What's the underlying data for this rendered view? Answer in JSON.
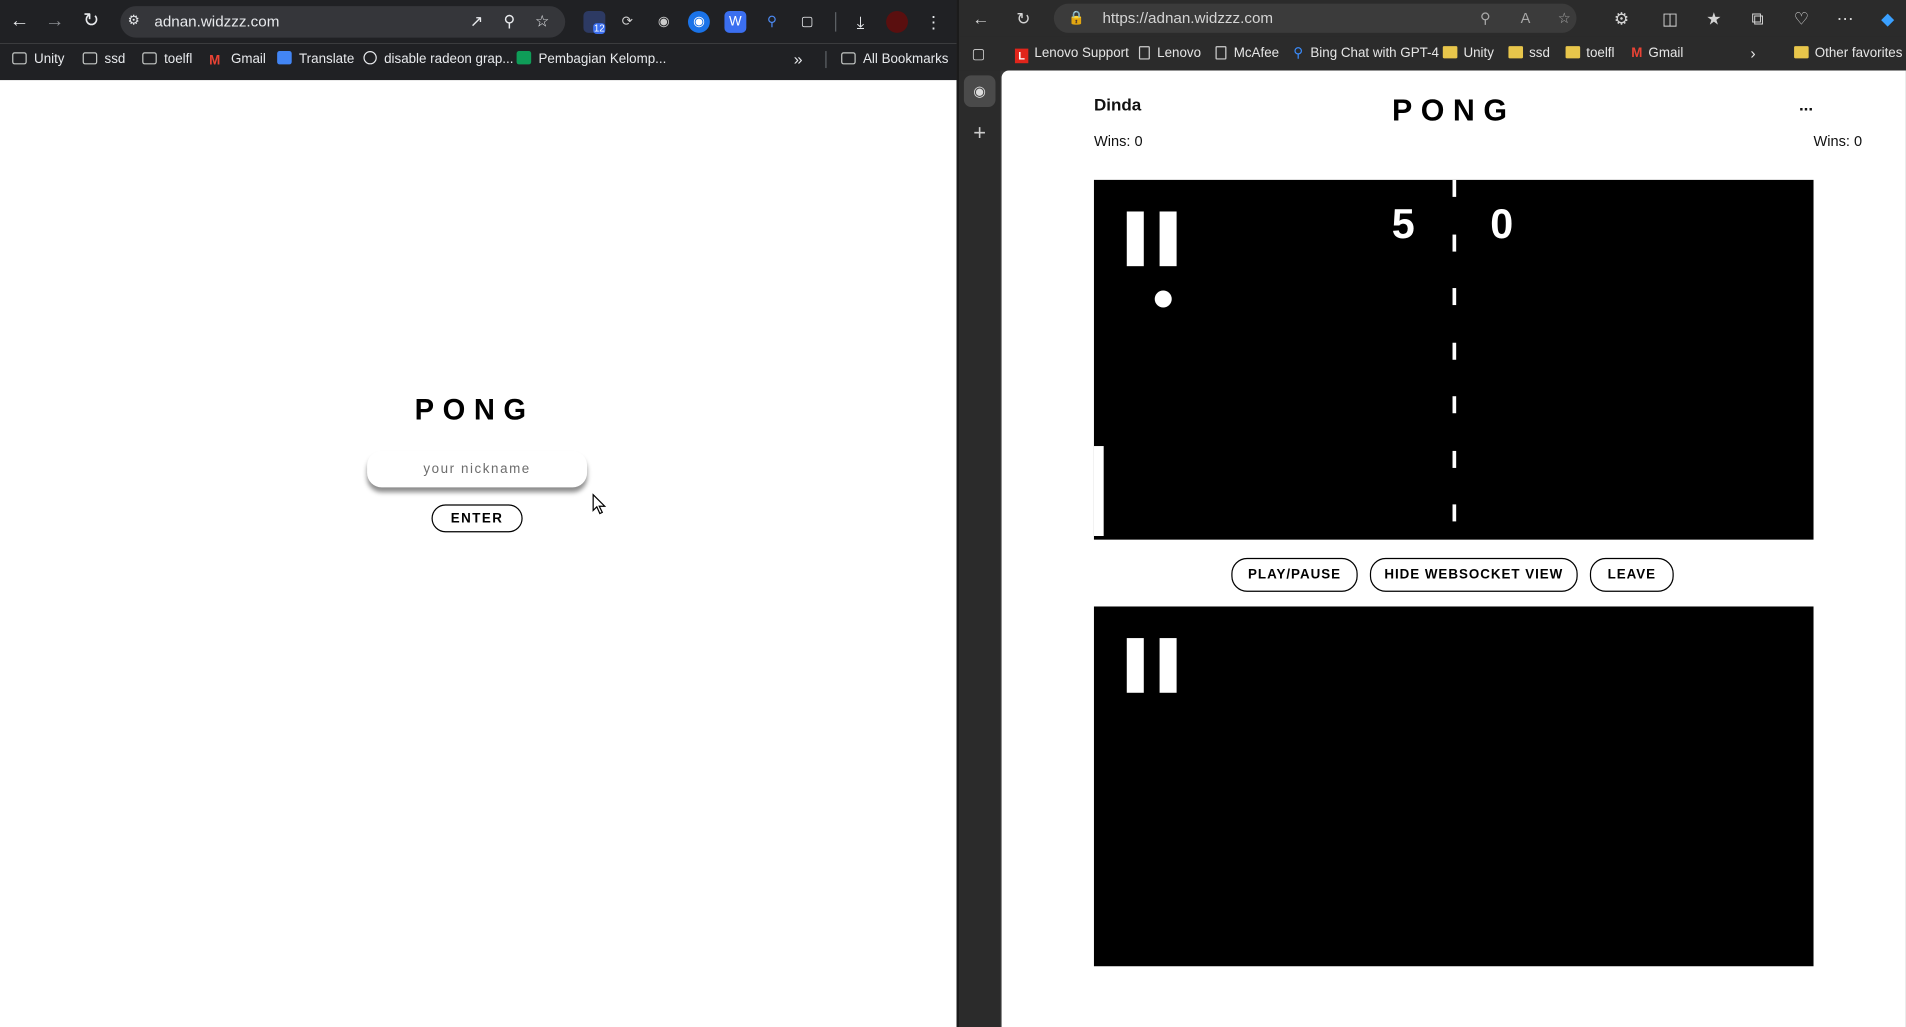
{
  "left_browser": {
    "url": "adnan.widzzz.com",
    "bookmarks": [
      "Unity",
      "ssd",
      "toelfl",
      "Gmail",
      "Translate",
      "disable radeon grap...",
      "Pembagian Kelomp..."
    ],
    "all_bookmarks": "All Bookmarks",
    "extension_badge": "12",
    "page": {
      "title": "PONG",
      "nickname_placeholder": "your nickname",
      "enter_label": "ENTER"
    }
  },
  "right_browser": {
    "url": "https://adnan.widzzz.com",
    "bookmarks": [
      "Lenovo Support",
      "Lenovo",
      "McAfee",
      "Bing Chat with GPT-4",
      "Unity",
      "ssd",
      "toelfl",
      "Gmail"
    ],
    "other_favorites": "Other favorites",
    "page": {
      "player_name": "Dinda",
      "title": "PONG",
      "menu": "...",
      "wins_left": "Wins: 0",
      "wins_right": "Wins: 0",
      "score_left": "5",
      "score_right": "0",
      "buttons": {
        "play_pause": "PLAY/PAUSE",
        "hide_ws": "HIDE WEBSOCKET VIEW",
        "leave": "LEAVE"
      }
    }
  },
  "colors": {
    "chrome_dark": "#202124",
    "edge_dark": "#2b2b2b",
    "court": "#000000",
    "folder_yellow": "#e8c64b",
    "gmail_red": "#ea4335"
  }
}
